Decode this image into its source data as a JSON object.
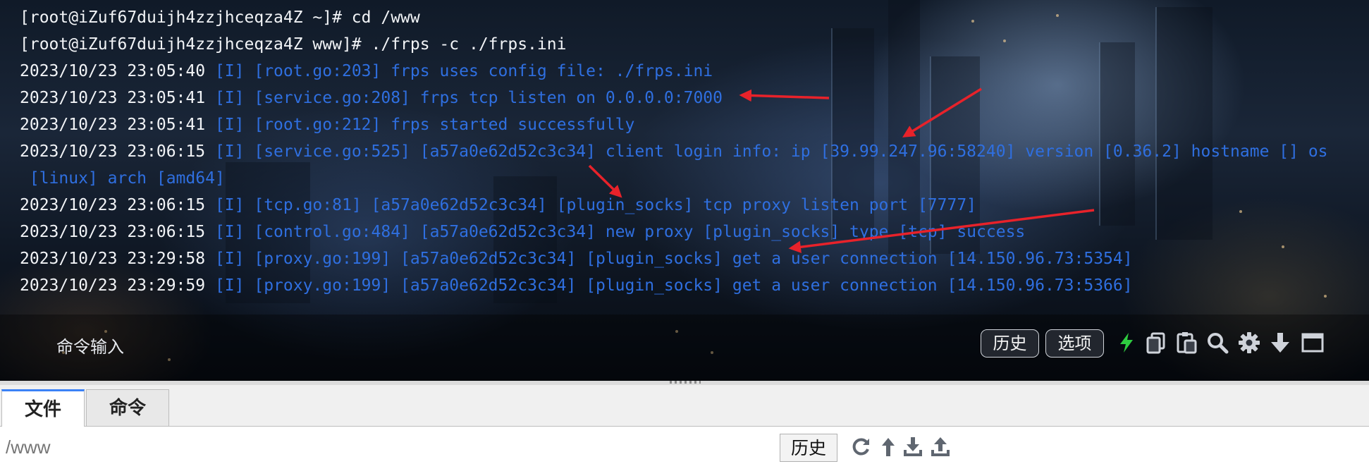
{
  "terminal": {
    "lines": [
      [
        {
          "t": "[root@iZuf67duijh4zzjhceqza4Z ~]# cd /www",
          "c": "w"
        }
      ],
      [
        {
          "t": "[root@iZuf67duijh4zzjhceqza4Z www]# ./frps -c ./frps.ini",
          "c": "w"
        }
      ],
      [
        {
          "t": "2023/10/23 23:05:40 ",
          "c": "w"
        },
        {
          "t": "[I] [root.go:203] frps uses config file: ./frps.ini",
          "c": "b"
        }
      ],
      [
        {
          "t": "2023/10/23 23:05:41 ",
          "c": "w"
        },
        {
          "t": "[I] [service.go:208] frps tcp listen on 0.0.0.0:7000",
          "c": "b"
        }
      ],
      [
        {
          "t": "2023/10/23 23:05:41 ",
          "c": "w"
        },
        {
          "t": "[I] [root.go:212] frps started successfully",
          "c": "b"
        }
      ],
      [
        {
          "t": "2023/10/23 23:06:15 ",
          "c": "w"
        },
        {
          "t": "[I] [service.go:525] [a57a0e62d52c3c34] client login info: ip [39.99.247.96:58240] version [0.36.2] hostname [] os",
          "c": "b"
        }
      ],
      [
        {
          "t": " [linux] arch [amd64]",
          "c": "b"
        }
      ],
      [
        {
          "t": "2023/10/23 23:06:15 ",
          "c": "w"
        },
        {
          "t": "[I] [tcp.go:81] [a57a0e62d52c3c34] [plugin_socks] tcp proxy listen port [7777]",
          "c": "b"
        }
      ],
      [
        {
          "t": "2023/10/23 23:06:15 ",
          "c": "w"
        },
        {
          "t": "[I] [control.go:484] [a57a0e62d52c3c34] new proxy [plugin_socks] type [tcp] success",
          "c": "b"
        }
      ],
      [
        {
          "t": "2023/10/23 23:29:58 ",
          "c": "w"
        },
        {
          "t": "[I] [proxy.go:199] [a57a0e62d52c3c34] [plugin_socks] get a user connection [14.150.96.73:5354]",
          "c": "b"
        }
      ],
      [
        {
          "t": "2023/10/23 23:29:59 ",
          "c": "w"
        },
        {
          "t": "[I] [proxy.go:199] [a57a0e62d52c3c34] [plugin_socks] get a user connection [14.150.96.73:5366]",
          "c": "b"
        }
      ]
    ],
    "colors": {
      "w": "#f2f4f7",
      "b": "#2f6fe0",
      "arrow": "#e8222a"
    },
    "command_input_label": "命令输入",
    "history_label": "历史",
    "options_label": "选项",
    "icons": [
      "lightning-icon",
      "copy-icon",
      "paste-icon",
      "search-icon",
      "gear-icon",
      "download-arrow-icon",
      "window-icon"
    ]
  },
  "bottom": {
    "tabs": [
      {
        "label": "文件",
        "active": true
      },
      {
        "label": "命令",
        "active": false
      }
    ],
    "path_value": "",
    "path_placeholder": "/www",
    "history_label": "历史",
    "icons": [
      "refresh-icon",
      "up-directory-icon",
      "download-icon",
      "upload-icon"
    ]
  }
}
